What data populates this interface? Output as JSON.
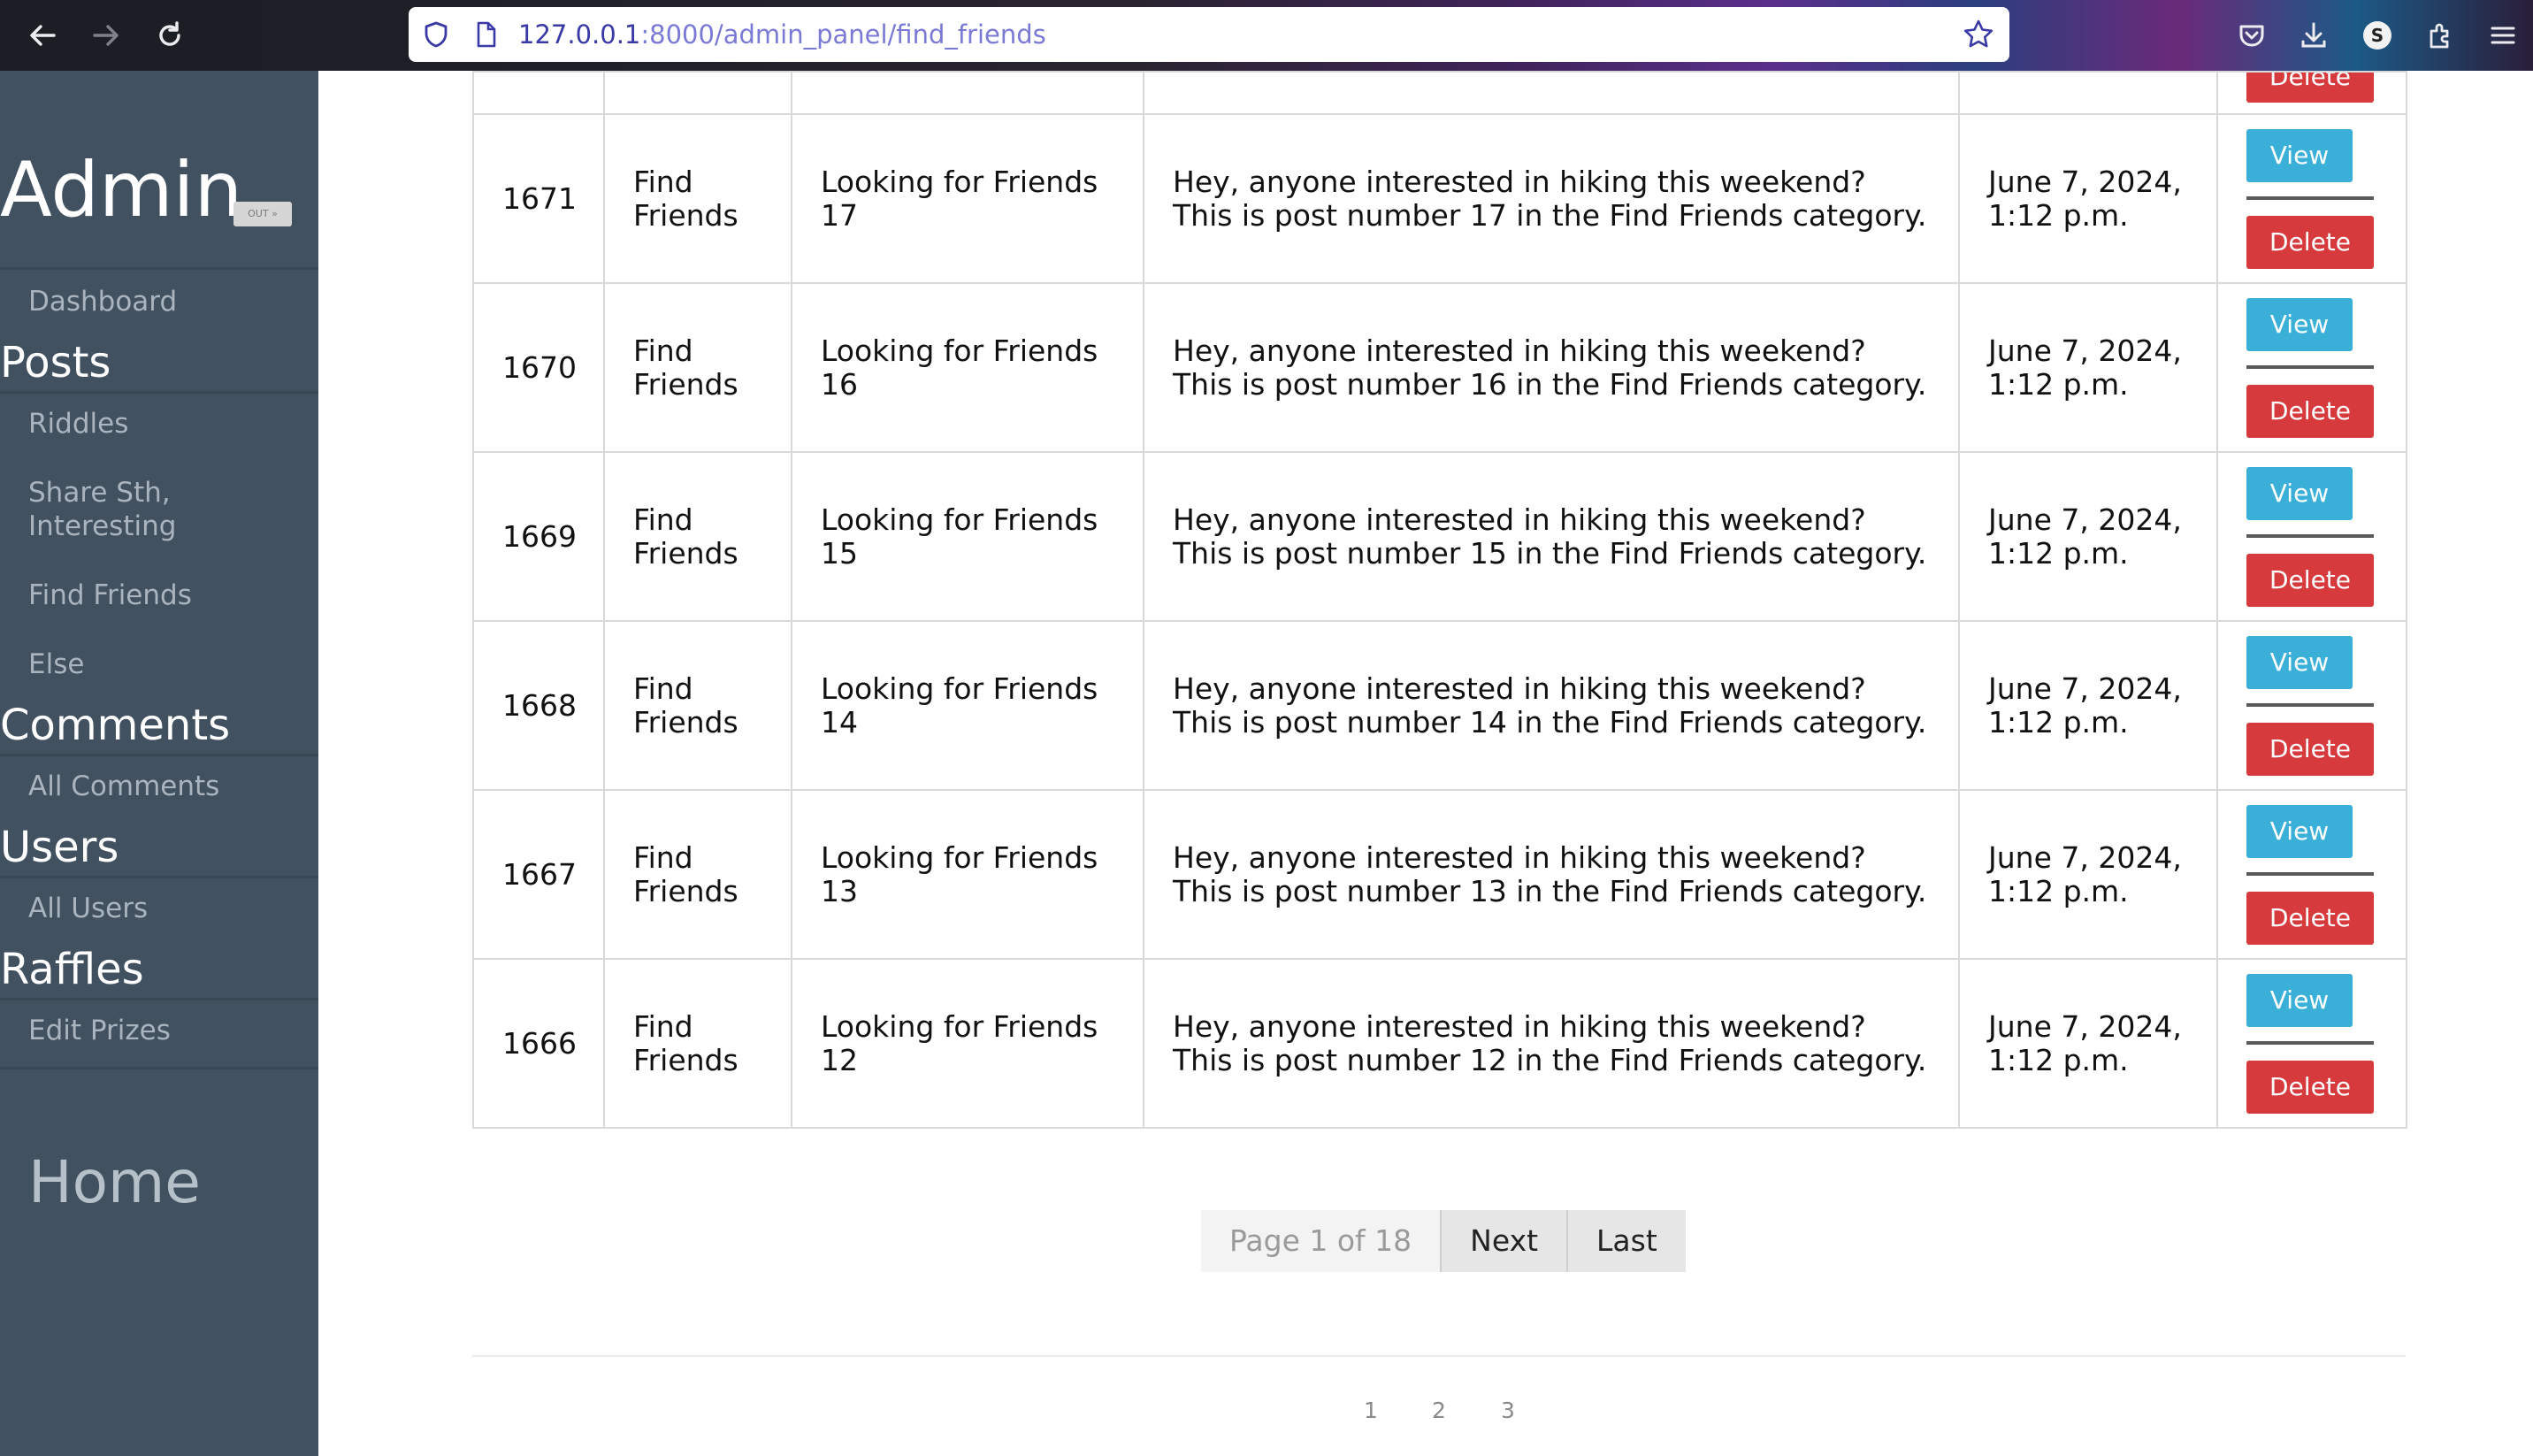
{
  "browser": {
    "url_host": "127.0.0.1",
    "url_path": ":8000/admin_panel/find_friends"
  },
  "sidebar": {
    "brand": "Admin",
    "badge": "OUT »",
    "dashboard": "Dashboard",
    "posts_heading": "Posts",
    "riddles": "Riddles",
    "share_line1": "Share Sth,",
    "share_line2": "Interesting",
    "find_friends": "Find Friends",
    "else": "Else",
    "comments_heading": "Comments",
    "all_comments": "All Comments",
    "users_heading": "Users",
    "all_users": "All Users",
    "raffles_heading": "Raffles",
    "edit_prizes": "Edit Prizes",
    "home": "Home"
  },
  "table": {
    "partial_delete": "Delete",
    "view_label": "View",
    "delete_label": "Delete",
    "rows": [
      {
        "id": "1671",
        "category": "Find Friends",
        "title": "Looking for Friends 17",
        "content": "Hey, anyone interested in hiking this weekend? This is post number 17 in the Find Friends category.",
        "date": "June 7, 2024, 1:12 p.m."
      },
      {
        "id": "1670",
        "category": "Find Friends",
        "title": "Looking for Friends 16",
        "content": "Hey, anyone interested in hiking this weekend? This is post number 16 in the Find Friends category.",
        "date": "June 7, 2024, 1:12 p.m."
      },
      {
        "id": "1669",
        "category": "Find Friends",
        "title": "Looking for Friends 15",
        "content": "Hey, anyone interested in hiking this weekend? This is post number 15 in the Find Friends category.",
        "date": "June 7, 2024, 1:12 p.m."
      },
      {
        "id": "1668",
        "category": "Find Friends",
        "title": "Looking for Friends 14",
        "content": "Hey, anyone interested in hiking this weekend? This is post number 14 in the Find Friends category.",
        "date": "June 7, 2024, 1:12 p.m."
      },
      {
        "id": "1667",
        "category": "Find Friends",
        "title": "Looking for Friends 13",
        "content": "Hey, anyone interested in hiking this weekend? This is post number 13 in the Find Friends category.",
        "date": "June 7, 2024, 1:12 p.m."
      },
      {
        "id": "1666",
        "category": "Find Friends",
        "title": "Looking for Friends 12",
        "content": "Hey, anyone interested in hiking this weekend? This is post number 12 in the Find Friends category.",
        "date": "June 7, 2024, 1:12 p.m."
      }
    ]
  },
  "pagination": {
    "info": "Page 1 of 18",
    "next": "Next",
    "last": "Last",
    "page_numbers": [
      "1",
      "2",
      "3"
    ]
  },
  "colors": {
    "sidebar_bg": "#415160",
    "view_button": "#3aafd8",
    "delete_button": "#d63a3d"
  },
  "icons": [
    "back-arrow-icon",
    "forward-arrow-icon",
    "reload-icon",
    "shield-icon",
    "page-icon",
    "bookmark-star-icon",
    "pocket-icon",
    "download-icon",
    "account-icon",
    "extensions-icon",
    "menu-icon"
  ]
}
